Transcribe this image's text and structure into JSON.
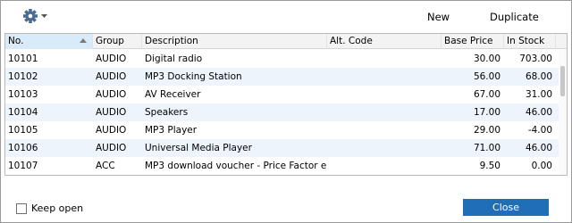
{
  "toolbar": {
    "settings_icon": "gear-icon",
    "new_label": "New",
    "duplicate_label": "Duplicate"
  },
  "table": {
    "columns": [
      "No.",
      "Group",
      "Description",
      "Alt. Code",
      "Base Price",
      "In Stock"
    ],
    "sorted_column": "No.",
    "sort_direction": "ascending",
    "rows": [
      {
        "no": "10101",
        "group": "AUDIO",
        "description": "Digital radio",
        "alt_code": "",
        "base_price": "30.00",
        "in_stock": "703.00"
      },
      {
        "no": "10102",
        "group": "AUDIO",
        "description": "MP3 Docking Station",
        "alt_code": "",
        "base_price": "56.00",
        "in_stock": "68.00"
      },
      {
        "no": "10103",
        "group": "AUDIO",
        "description": "AV Receiver",
        "alt_code": "",
        "base_price": "67.00",
        "in_stock": "31.00"
      },
      {
        "no": "10104",
        "group": "AUDIO",
        "description": "Speakers",
        "alt_code": "",
        "base_price": "17.00",
        "in_stock": "46.00"
      },
      {
        "no": "10105",
        "group": "AUDIO",
        "description": "MP3 Player",
        "alt_code": "",
        "base_price": "29.00",
        "in_stock": "-4.00"
      },
      {
        "no": "10106",
        "group": "AUDIO",
        "description": "Universal Media Player",
        "alt_code": "",
        "base_price": "71.00",
        "in_stock": "46.00"
      },
      {
        "no": "10107",
        "group": "ACC",
        "description": "MP3 download voucher - Price Factor e...",
        "alt_code": "",
        "base_price": "9.50",
        "in_stock": "0.00"
      }
    ]
  },
  "footer": {
    "keep_open_label": "Keep open",
    "keep_open_checked": false,
    "close_label": "Close"
  },
  "colors": {
    "accent": "#1f6eb6",
    "alt_row": "#eef4fb",
    "sorted_header": "#d9ebf9"
  }
}
